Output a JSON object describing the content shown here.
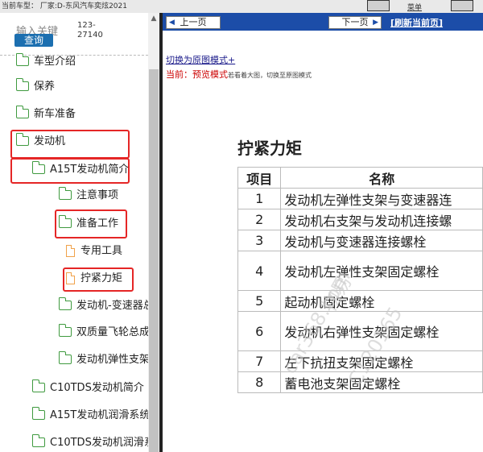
{
  "top_bar": {
    "vehicle_text": "当前车型：  厂家:D-东风汽车奕炫2021",
    "right_text": "菜单"
  },
  "left_panel": {
    "search_label": "输入关键",
    "search_button": "查询",
    "code_text": "123-27140",
    "tree": [
      {
        "label": "车型介绍",
        "icon": "folder-icon"
      },
      {
        "label": "保养",
        "icon": "folder-icon"
      },
      {
        "label": "新车准备",
        "icon": "folder-icon"
      },
      {
        "label": "发动机",
        "icon": "folder-open-icon"
      },
      {
        "label": "A15T发动机简介",
        "icon": "folder-open-icon"
      },
      {
        "label": "注意事项",
        "icon": "folder-icon"
      },
      {
        "label": "准备工作",
        "icon": "folder-open-icon"
      },
      {
        "label": "专用工具",
        "icon": "document-icon"
      },
      {
        "label": "拧紧力矩",
        "icon": "document-icon"
      },
      {
        "label": "发动机-变速器总",
        "icon": "folder-icon"
      },
      {
        "label": "双质量飞轮总成",
        "icon": "folder-icon"
      },
      {
        "label": "发动机弹性支架",
        "icon": "folder-icon"
      },
      {
        "label": "C10TDS发动机简介",
        "icon": "folder-icon"
      },
      {
        "label": "A15T发动机润滑系统",
        "icon": "folder-icon"
      },
      {
        "label": "C10TDS发动机润滑系",
        "icon": "folder-icon"
      }
    ]
  },
  "nav": {
    "prev_label": "上一页",
    "next_label": "下一页",
    "refresh_label": "[刷新当前页]"
  },
  "view": {
    "switch_link": "切换为原图模式+",
    "mode_prefix": "当前：",
    "mode_value": "预览模式",
    "mode_hint": "若看着大图，切换至原图模式"
  },
  "document": {
    "title": "拧紧力矩",
    "columns": [
      "项目",
      "名称"
    ],
    "rows": [
      {
        "num": "1",
        "name": "发动机左弹性支架与变速器连"
      },
      {
        "num": "2",
        "name": "发动机右支架与发动机连接螺"
      },
      {
        "num": "3",
        "name": "发动机与变速器连接螺栓"
      },
      {
        "num": "4",
        "name": "发动机左弹性支架固定螺栓"
      },
      {
        "num": "5",
        "name": "起动机固定螺栓"
      },
      {
        "num": "6",
        "name": "发动机右弹性支架固定螺栓"
      },
      {
        "num": "7",
        "name": "左下抗扭支架固定螺栓"
      },
      {
        "num": "8",
        "name": "蓄电池支架固定螺栓"
      }
    ]
  },
  "watermarks": [
    "物易",
    "car368.com",
    "C120165"
  ],
  "colors": {
    "nav_blue": "#1c4da8",
    "search_blue": "#1c6fb0",
    "highlight_red": "#e52626",
    "folder_green": "#3f9a3f",
    "doc_orange": "#f0a24a"
  }
}
